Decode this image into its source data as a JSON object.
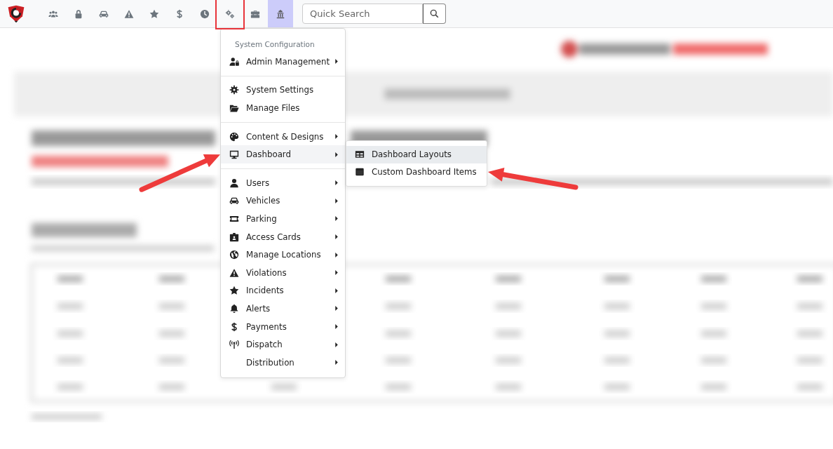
{
  "toolbar": {
    "logo": {
      "kind": "logo"
    },
    "icons": [
      {
        "kind": "users",
        "selected": false,
        "marked": false
      },
      {
        "kind": "lock",
        "selected": false,
        "marked": false
      },
      {
        "kind": "car",
        "selected": false,
        "marked": false
      },
      {
        "kind": "warning",
        "selected": false,
        "marked": false
      },
      {
        "kind": "star",
        "selected": false,
        "marked": false
      },
      {
        "kind": "dollar",
        "selected": false,
        "marked": false
      },
      {
        "kind": "clock",
        "selected": false,
        "marked": false
      },
      {
        "kind": "gears",
        "selected": false,
        "marked": true
      },
      {
        "kind": "toolbox",
        "selected": false,
        "marked": false
      },
      {
        "kind": "building",
        "selected": true,
        "marked": false
      }
    ],
    "search": {
      "placeholder": "Quick Search"
    }
  },
  "menu": {
    "header": "System Configuration",
    "groups": [
      {
        "items": [
          {
            "label": "Admin Management",
            "kind": "user-lock",
            "submenu": true,
            "highlighted": false
          }
        ]
      },
      {
        "items": [
          {
            "label": "System Settings",
            "kind": "gear",
            "submenu": false,
            "highlighted": false
          },
          {
            "label": "Manage Files",
            "kind": "folder",
            "submenu": false,
            "highlighted": false
          }
        ]
      },
      {
        "items": [
          {
            "label": "Content & Designs",
            "kind": "palette",
            "submenu": true,
            "highlighted": false
          },
          {
            "label": "Dashboard",
            "kind": "monitor",
            "submenu": true,
            "highlighted": true
          }
        ]
      },
      {
        "items": [
          {
            "label": "Users",
            "kind": "user",
            "submenu": true,
            "highlighted": false
          },
          {
            "label": "Vehicles",
            "kind": "car",
            "submenu": true,
            "highlighted": false
          },
          {
            "label": "Parking",
            "kind": "ticket",
            "submenu": true,
            "highlighted": false
          },
          {
            "label": "Access Cards",
            "kind": "id-card",
            "submenu": true,
            "highlighted": false
          },
          {
            "label": "Manage Locations",
            "kind": "globe",
            "submenu": true,
            "highlighted": false
          },
          {
            "label": "Violations",
            "kind": "warning",
            "submenu": true,
            "highlighted": false
          },
          {
            "label": "Incidents",
            "kind": "star",
            "submenu": true,
            "highlighted": false
          },
          {
            "label": "Alerts",
            "kind": "bell",
            "submenu": true,
            "highlighted": false
          },
          {
            "label": "Payments",
            "kind": "dollar",
            "submenu": true,
            "highlighted": false
          },
          {
            "label": "Dispatch",
            "kind": "antenna",
            "submenu": true,
            "highlighted": false
          },
          {
            "label": "Distribution",
            "kind": "none",
            "submenu": true,
            "highlighted": false
          }
        ]
      }
    ]
  },
  "submenu": {
    "items": [
      {
        "label": "Dashboard Layouts",
        "kind": "table",
        "highlighted": true
      },
      {
        "label": "Custom Dashboard Items",
        "kind": "window",
        "highlighted": false
      }
    ]
  },
  "annotations": [
    {
      "kind": "arrow"
    },
    {
      "kind": "arrow"
    }
  ],
  "page": {
    "kind": "blurred"
  }
}
